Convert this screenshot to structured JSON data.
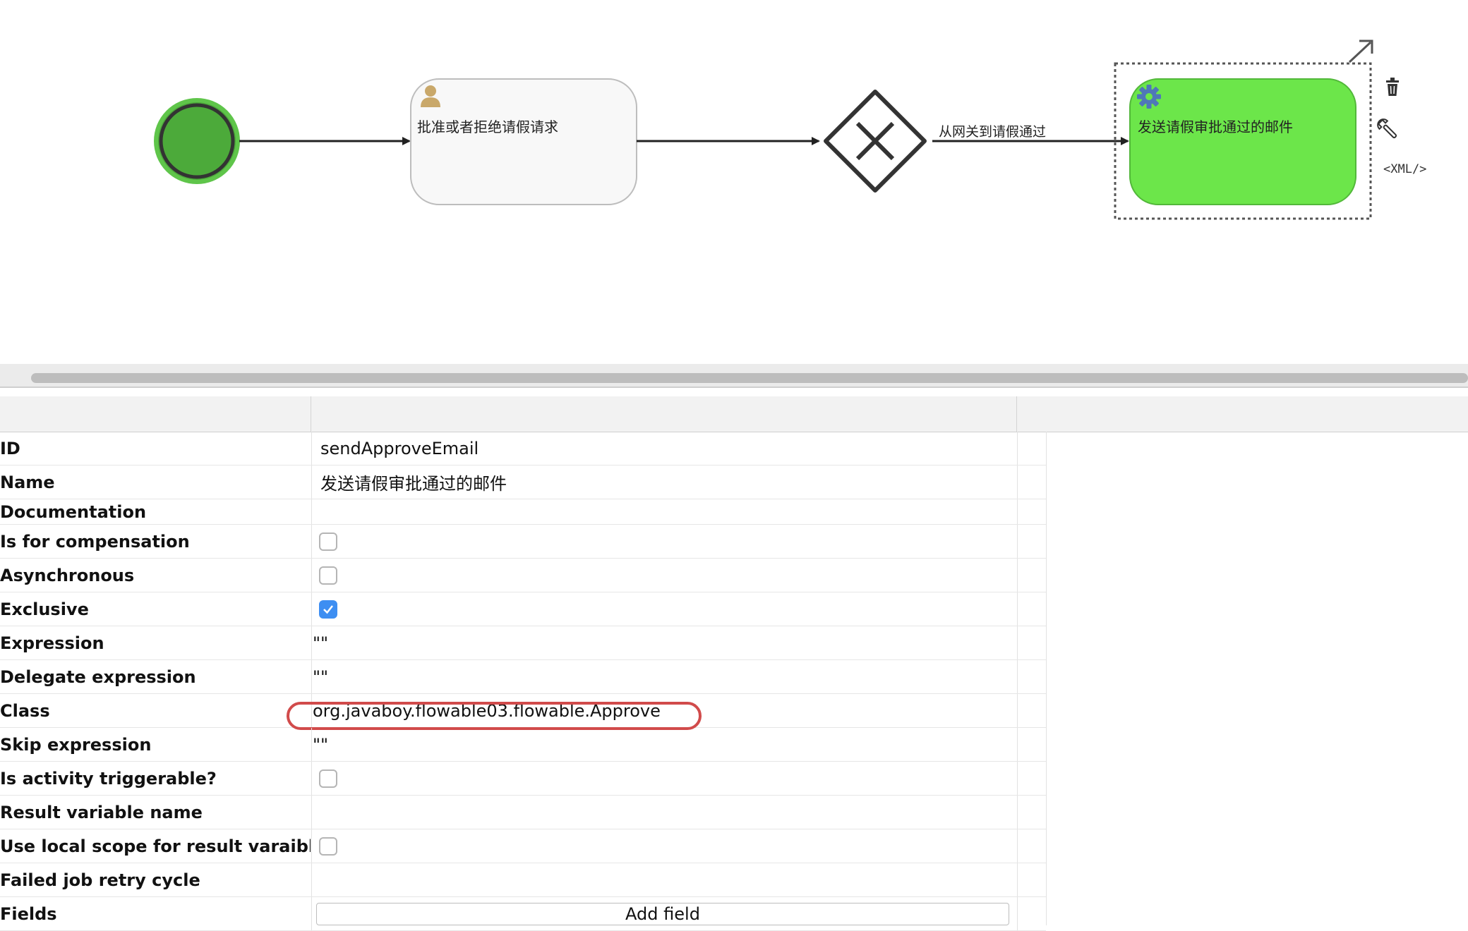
{
  "diagram": {
    "task1_name": "批准或者拒绝请假请求",
    "flow_label": "从网关到请假通过",
    "task2_name": "发送请假审批通过的邮件",
    "xml_label": "<XML/>",
    "colors": {
      "start_fill": "#4caa3a",
      "start_border": "#333333",
      "selected_task_fill": "#6ce64a",
      "user_task_fill": "#f8f8f8",
      "gear_icon": "#4f77b8",
      "user_icon": "#c9a86a"
    }
  },
  "properties": {
    "rows": [
      {
        "label": "ID",
        "value": "sendApproveEmail"
      },
      {
        "label": "Name",
        "value": "发送请假审批通过的邮件"
      },
      {
        "label": "Documentation",
        "value": ""
      },
      {
        "label": "Is for compensation",
        "checked": false
      },
      {
        "label": "Asynchronous",
        "checked": false
      },
      {
        "label": "Exclusive",
        "checked": true
      },
      {
        "label": "Expression",
        "value": "\"\""
      },
      {
        "label": "Delegate expression",
        "value": "\"\""
      },
      {
        "label": "Class",
        "value": "org.javaboy.flowable03.flowable.Approve"
      },
      {
        "label": "Skip expression",
        "value": "\"\""
      },
      {
        "label": "Is activity triggerable?",
        "checked": false
      },
      {
        "label": "Result variable name",
        "value": ""
      },
      {
        "label": "Use local scope for result varaible",
        "checked": false
      },
      {
        "label": "Failed job retry cycle",
        "value": ""
      },
      {
        "label": "Fields",
        "button": "Add field"
      }
    ]
  }
}
